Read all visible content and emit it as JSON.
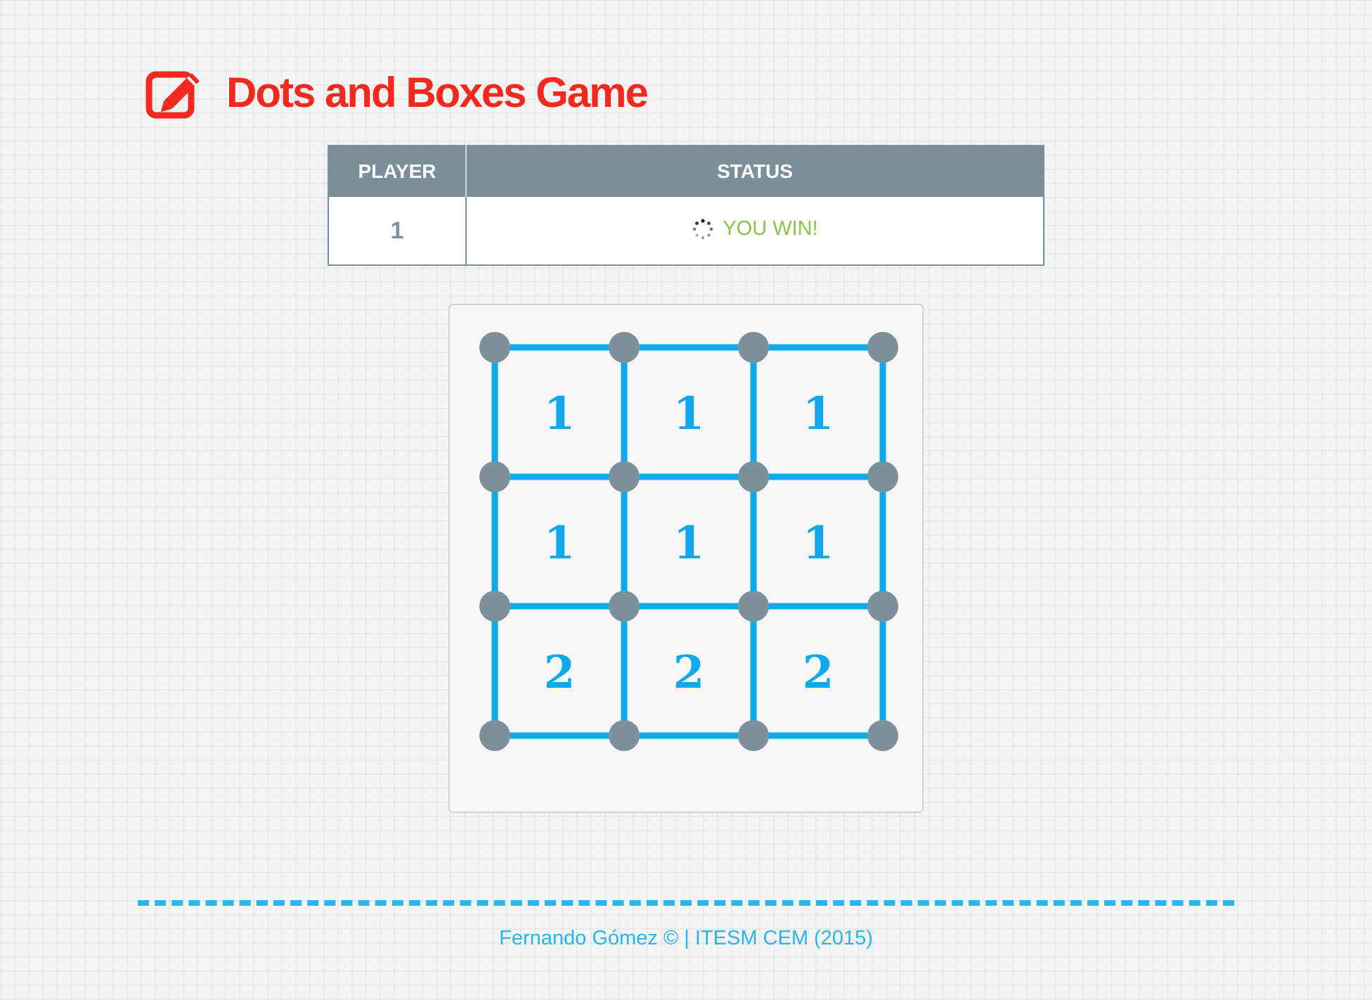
{
  "header": {
    "title": "Dots and Boxes Game",
    "icon": "edit-icon",
    "title_color": "#f2291d"
  },
  "status_table": {
    "columns": [
      "PLAYER",
      "STATUS"
    ],
    "player": "1",
    "status": "YOU WIN!",
    "status_icon": "spinner-icon",
    "header_color": "#7b909a",
    "status_color": "#8bc34a"
  },
  "board": {
    "rows": 3,
    "cols": 3,
    "line_color": "#0ea9ec",
    "dot_color": "#7b909a",
    "boxes": [
      [
        "1",
        "1",
        "1"
      ],
      [
        "1",
        "1",
        "1"
      ],
      [
        "2",
        "2",
        "2"
      ]
    ]
  },
  "footer": {
    "text": "Fernando Gómez © | ITESM CEM (2015)",
    "color": "#29b6e8"
  }
}
